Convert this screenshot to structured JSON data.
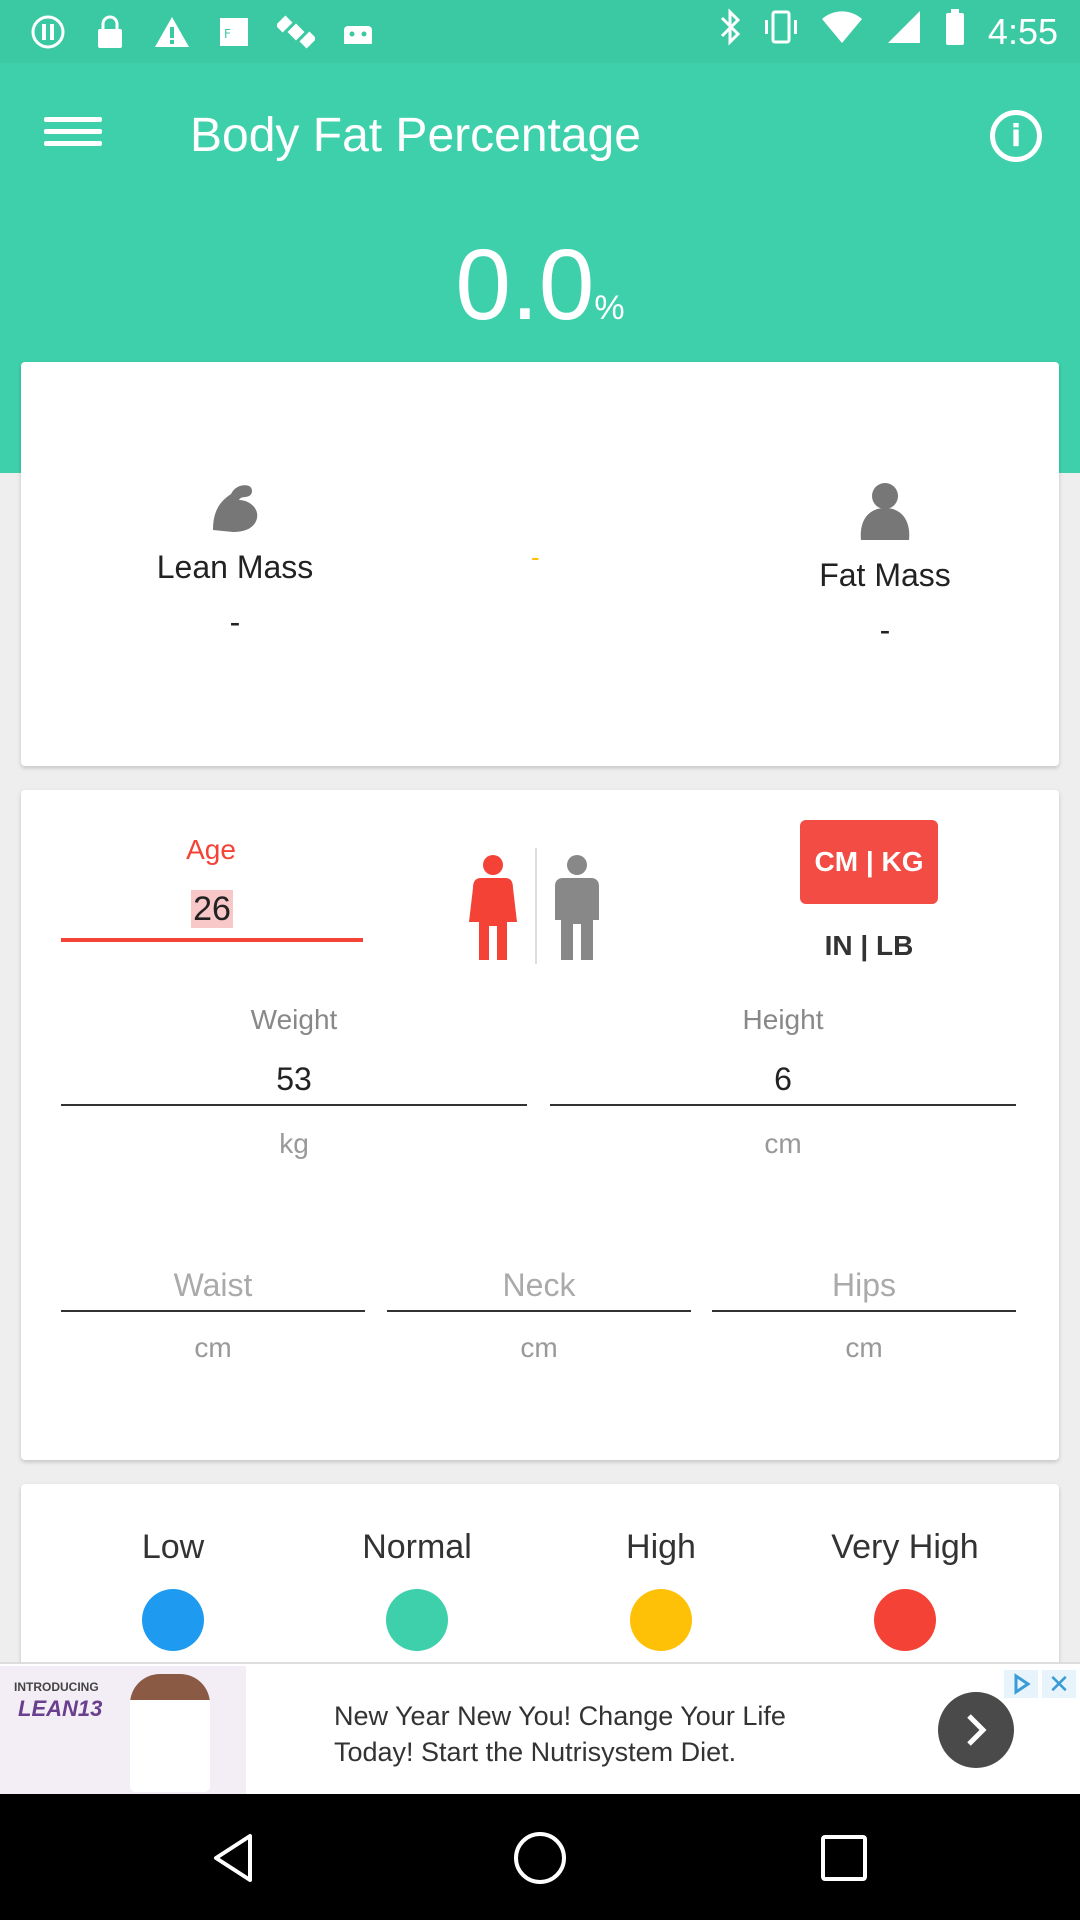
{
  "status_bar": {
    "time": "4:55",
    "icons_left": [
      "info-circle-icon",
      "lock-icon",
      "warning-icon",
      "fake-gps-icon",
      "satellite-icon",
      "android-icon"
    ],
    "icons_right": [
      "bluetooth-icon",
      "vibrate-icon",
      "wifi-icon",
      "signal-icon",
      "battery-icon"
    ]
  },
  "header": {
    "title": "Body Fat Percentage",
    "result_value": "0.0",
    "result_unit": "%"
  },
  "mass": {
    "lean_label": "Lean Mass",
    "lean_value": "-",
    "separator": "-",
    "fat_label": "Fat Mass",
    "fat_value": "-"
  },
  "inputs": {
    "age_label": "Age",
    "age_value": "26",
    "unit_metric": "CM | KG",
    "unit_imperial": "IN | LB",
    "weight_label": "Weight",
    "weight_value": "53",
    "weight_unit": "kg",
    "height_label": "Height",
    "height_value": "6",
    "height_unit": "cm",
    "waist_placeholder": "Waist",
    "waist_unit": "cm",
    "neck_placeholder": "Neck",
    "neck_unit": "cm",
    "hips_placeholder": "Hips",
    "hips_unit": "cm",
    "selected_gender": "female"
  },
  "legend": [
    {
      "label": "Low",
      "color": "#1E9BF0"
    },
    {
      "label": "Normal",
      "color": "#3ED0AB"
    },
    {
      "label": "High",
      "color": "#FFC107"
    },
    {
      "label": "Very High",
      "color": "#F44336"
    }
  ],
  "ad": {
    "brand_small": "INTRODUCING",
    "brand_big": "LEAN13",
    "text_line1": "New Year New You! Change Your Life",
    "text_line2": "Today! Start the Nutrisystem Diet."
  },
  "colors": {
    "primary": "#3ED0AB",
    "accent_red": "#F34C45",
    "female_icon": "#F44336",
    "male_icon": "#888888"
  }
}
